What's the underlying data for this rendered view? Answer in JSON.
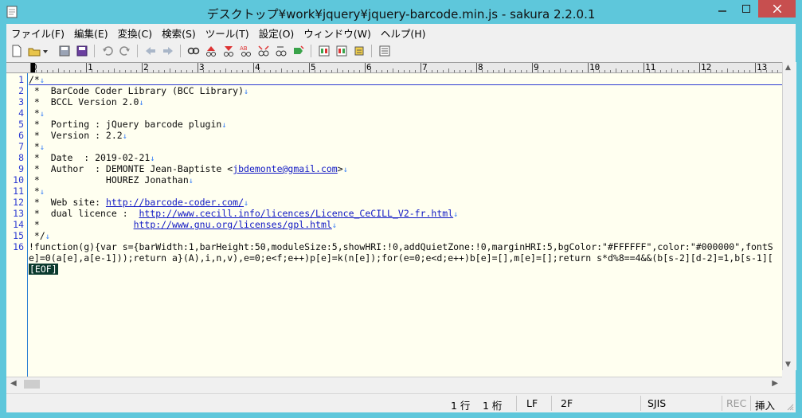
{
  "window": {
    "title": "デスクトップ¥work¥jquery¥jquery-barcode.min.js - sakura 2.2.0.1"
  },
  "menus": [
    {
      "label": "ファイル(F)"
    },
    {
      "label": "編集(E)"
    },
    {
      "label": "変換(C)"
    },
    {
      "label": "検索(S)"
    },
    {
      "label": "ツール(T)"
    },
    {
      "label": "設定(O)"
    },
    {
      "label": "ウィンドウ(W)"
    },
    {
      "label": "ヘルプ(H)"
    }
  ],
  "toolbar_icons": [
    "new-file-icon",
    "open-file-icon",
    "dropdown-arrow-icon",
    "save-icon",
    "save-all-icon",
    "undo-icon",
    "redo-icon",
    "jump-back-icon",
    "jump-forward-icon",
    "search-icon",
    "search-previous-icon",
    "search-next-icon",
    "replace-icon",
    "grep-icon",
    "jump-to-icon",
    "bookmark-icon",
    "compare-icon",
    "outline-icon",
    "tag-jump-icon",
    "settings-icon"
  ],
  "ruler": {
    "marks": [
      "0",
      "1",
      "2",
      "3",
      "4",
      "5",
      "6",
      "7",
      "8",
      "9",
      "10",
      "11",
      "12",
      "13"
    ]
  },
  "editor": {
    "lines": [
      {
        "num": "1",
        "segments": [
          {
            "text": "/*"
          }
        ]
      },
      {
        "num": "2",
        "segments": [
          {
            "text": " *  BarCode Coder Library (BCC Library)"
          }
        ]
      },
      {
        "num": "3",
        "segments": [
          {
            "text": " *  BCCL Version 2.0"
          }
        ]
      },
      {
        "num": "4",
        "segments": [
          {
            "text": " *"
          }
        ]
      },
      {
        "num": "5",
        "segments": [
          {
            "text": " *  Porting : jQuery barcode plugin"
          }
        ]
      },
      {
        "num": "6",
        "segments": [
          {
            "text": " *  Version : 2.2"
          }
        ]
      },
      {
        "num": "7",
        "segments": [
          {
            "text": " *"
          }
        ]
      },
      {
        "num": "8",
        "segments": [
          {
            "text": " *  Date  : 2019-02-21"
          }
        ]
      },
      {
        "num": "9",
        "segments": [
          {
            "text": " *  Author  : DEMONTE Jean-Baptiste <"
          },
          {
            "text": "jbdemonte@gmail.com",
            "link": true
          },
          {
            "text": ">"
          }
        ]
      },
      {
        "num": "10",
        "segments": [
          {
            "text": " *            HOUREZ Jonathan"
          }
        ]
      },
      {
        "num": "11",
        "segments": [
          {
            "text": " *"
          }
        ]
      },
      {
        "num": "12",
        "segments": [
          {
            "text": " *  Web site: "
          },
          {
            "text": "http://barcode-coder.com/",
            "link": true
          }
        ]
      },
      {
        "num": "13",
        "segments": [
          {
            "text": " *  dual licence :  "
          },
          {
            "text": "http://www.cecill.info/licences/Licence_CeCILL_V2-fr.html",
            "link": true
          }
        ]
      },
      {
        "num": "14",
        "segments": [
          {
            "text": " *                 "
          },
          {
            "text": "http://www.gnu.org/licenses/gpl.html",
            "link": true
          }
        ]
      },
      {
        "num": "15",
        "segments": [
          {
            "text": " */"
          }
        ]
      },
      {
        "num": "16",
        "segments": [
          {
            "text": "!function(g){var s={barWidth:1,barHeight:50,moduleSize:5,showHRI:!0,addQuietZone:!0,marginHRI:5,bgColor:\"#FFFFFF\",color:\"#000000\",fontS"
          }
        ]
      },
      {
        "num": "",
        "segments": [
          {
            "text": "e]=0(a[e],a[e-1]));return a}(A),i,n,v),e=0;e<f;e++)p[e]=k(n[e]);for(e=0;e<d;e++)b[e]=[],m[e]=[];return s*d%8==4&&(b[s-2][d-2]=1,b[s-1]["
          }
        ]
      }
    ],
    "eol_mark": "↓",
    "eof_mark": "[EOF]"
  },
  "status": {
    "line": "1 行",
    "column": "1 桁",
    "newline": "LF",
    "code_point": "2F",
    "encoding": "SJIS",
    "rec": "REC",
    "mode": "挿入"
  }
}
